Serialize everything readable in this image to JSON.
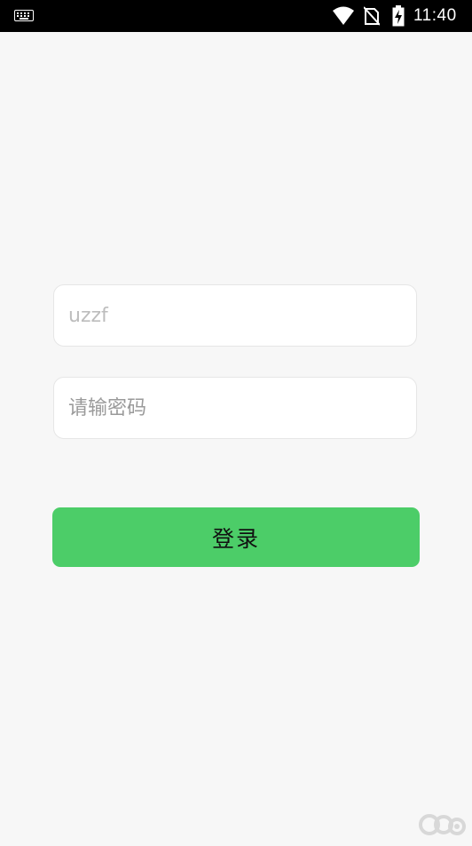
{
  "status_bar": {
    "time": "11:40",
    "icons": [
      "keyboard-icon",
      "wifi-icon",
      "no-sim-icon",
      "battery-charging-icon"
    ]
  },
  "login_form": {
    "username_placeholder": "uzzf",
    "password_placeholder": "请输密码",
    "login_label": "登录"
  },
  "watermark": {
    "icon": "pc6-logo-icon"
  },
  "colors": {
    "background": "#f7f7f7",
    "accent": "#4ccd68",
    "status_bar": "#000000"
  }
}
